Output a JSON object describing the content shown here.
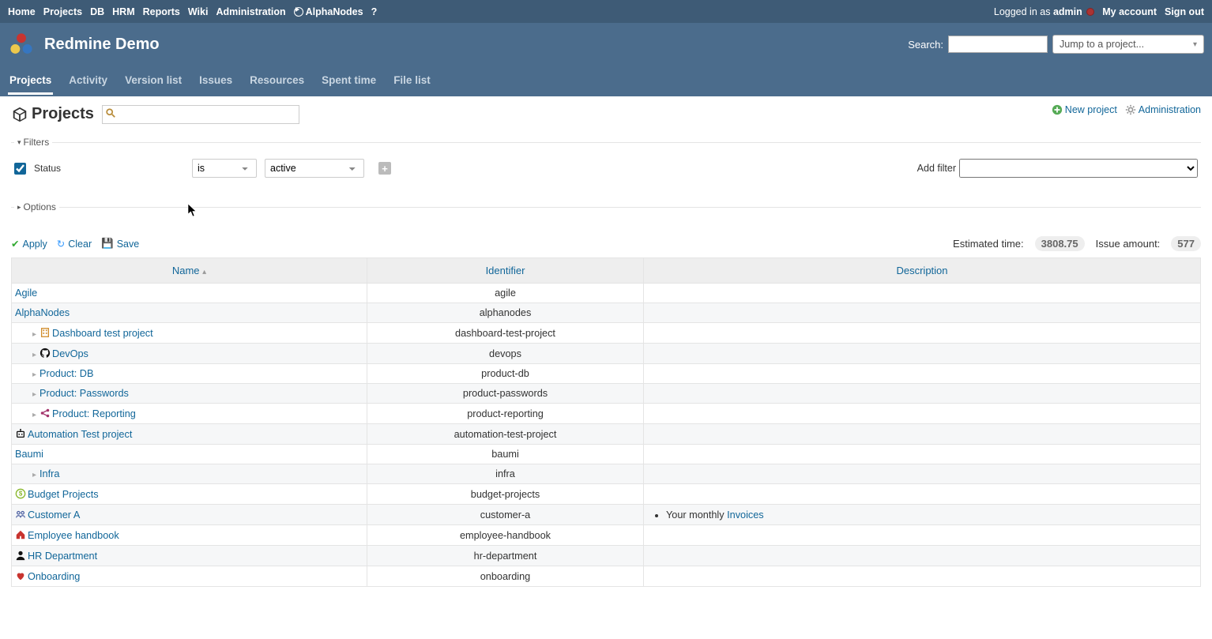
{
  "top_menu": {
    "left": [
      "Home",
      "Projects",
      "DB",
      "HRM",
      "Reports",
      "Wiki",
      "Administration",
      "AlphaNodes",
      "?"
    ],
    "logged_in_as": "Logged in as ",
    "user": "admin",
    "right": [
      "My account",
      "Sign out"
    ]
  },
  "header": {
    "title": "Redmine Demo",
    "search_label": "Search:",
    "jump_placeholder": "Jump to a project..."
  },
  "main_menu": [
    "Projects",
    "Activity",
    "Version list",
    "Issues",
    "Resources",
    "Spent time",
    "File list"
  ],
  "main_menu_selected": 0,
  "page_title": "Projects",
  "contextual": {
    "new_project": "New project",
    "administration": "Administration"
  },
  "filters": {
    "legend": "Filters",
    "status_label": "Status",
    "operator": "is",
    "value": "active",
    "add_filter_label": "Add filter"
  },
  "options_legend": "Options",
  "buttons": {
    "apply": "Apply",
    "clear": "Clear",
    "save": "Save"
  },
  "totals": {
    "estimated_label": "Estimated time:",
    "estimated_value": "3808.75",
    "issue_label": "Issue amount:",
    "issue_value": "577"
  },
  "columns": {
    "name": "Name",
    "identifier": "Identifier",
    "description": "Description"
  },
  "rows": [
    {
      "name": "Agile",
      "identifier": "agile",
      "indent": 0,
      "expander": false,
      "icon": null,
      "desc": ""
    },
    {
      "name": "AlphaNodes",
      "identifier": "alphanodes",
      "indent": 0,
      "expander": false,
      "icon": null,
      "desc": ""
    },
    {
      "name": "Dashboard test project",
      "identifier": "dashboard-test-project",
      "indent": 1,
      "expander": true,
      "icon": "building",
      "icon_color": "#d08c2a",
      "desc": ""
    },
    {
      "name": "DevOps",
      "identifier": "devops",
      "indent": 1,
      "expander": true,
      "icon": "github",
      "icon_color": "#111",
      "desc": ""
    },
    {
      "name": "Product: DB",
      "identifier": "product-db",
      "indent": 1,
      "expander": true,
      "icon": null,
      "desc": ""
    },
    {
      "name": "Product: Passwords",
      "identifier": "product-passwords",
      "indent": 1,
      "expander": true,
      "icon": null,
      "desc": ""
    },
    {
      "name": "Product: Reporting",
      "identifier": "product-reporting",
      "indent": 1,
      "expander": true,
      "icon": "share",
      "icon_color": "#a3336b",
      "desc": ""
    },
    {
      "name": "Automation Test project",
      "identifier": "automation-test-project",
      "indent": 0,
      "expander": false,
      "icon": "robot",
      "icon_color": "#111",
      "desc": ""
    },
    {
      "name": "Baumi",
      "identifier": "baumi",
      "indent": 0,
      "expander": false,
      "icon": null,
      "desc": ""
    },
    {
      "name": "Infra",
      "identifier": "infra",
      "indent": 1,
      "expander": true,
      "icon": null,
      "desc": ""
    },
    {
      "name": "Budget Projects",
      "identifier": "budget-projects",
      "indent": 0,
      "expander": false,
      "icon": "dollar",
      "icon_color": "#8ab82e",
      "desc": ""
    },
    {
      "name": "Customer A",
      "identifier": "customer-a",
      "indent": 0,
      "expander": false,
      "icon": "group",
      "icon_color": "#4a5ea0",
      "desc": "Your monthly ",
      "desc_link": "Invoices"
    },
    {
      "name": "Employee handbook",
      "identifier": "employee-handbook",
      "indent": 0,
      "expander": false,
      "icon": "home",
      "icon_color": "#c8342f",
      "desc": ""
    },
    {
      "name": "HR Department",
      "identifier": "hr-department",
      "indent": 0,
      "expander": false,
      "icon": "user",
      "icon_color": "#111",
      "desc": ""
    },
    {
      "name": "Onboarding",
      "identifier": "onboarding",
      "indent": 0,
      "expander": false,
      "icon": "heart",
      "icon_color": "#c8342f",
      "desc": ""
    }
  ]
}
